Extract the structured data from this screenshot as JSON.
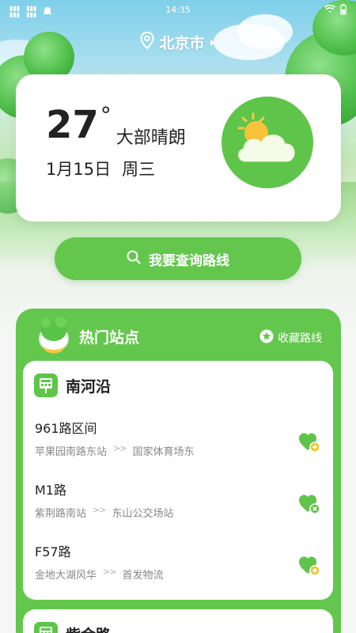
{
  "status_bar": {
    "time": "14:35"
  },
  "location": {
    "city": "北京市"
  },
  "weather": {
    "temperature": "27",
    "degree_symbol": "°",
    "condition": "大部晴朗",
    "date": "1月15日",
    "weekday": "周三"
  },
  "search_route": {
    "label": "我要查询路线"
  },
  "hot_stations": {
    "title": "热门站点",
    "favorite_label": "收藏路线",
    "stations": [
      {
        "name": "南河沿",
        "routes": [
          {
            "name": "961路区间",
            "from": "苹果园南路东站",
            "to": "国家体育场东",
            "separator": ">>",
            "favorite_icon": "heart-plus-icon"
          },
          {
            "name": "M1路",
            "from": "紫荆路南站",
            "to": "东山公交场站",
            "separator": ">>",
            "favorite_icon": "heart-remove-icon"
          },
          {
            "name": "F57路",
            "from": "金地大湖风华",
            "to": "首发物流",
            "separator": ">>",
            "favorite_icon": "heart-plus-icon"
          }
        ]
      },
      {
        "name": "紫金路"
      }
    ]
  },
  "colors": {
    "brand_green": "#63c74d",
    "badge_yellow": "#f5c518",
    "text_dark": "#222222",
    "text_muted": "#888888"
  }
}
